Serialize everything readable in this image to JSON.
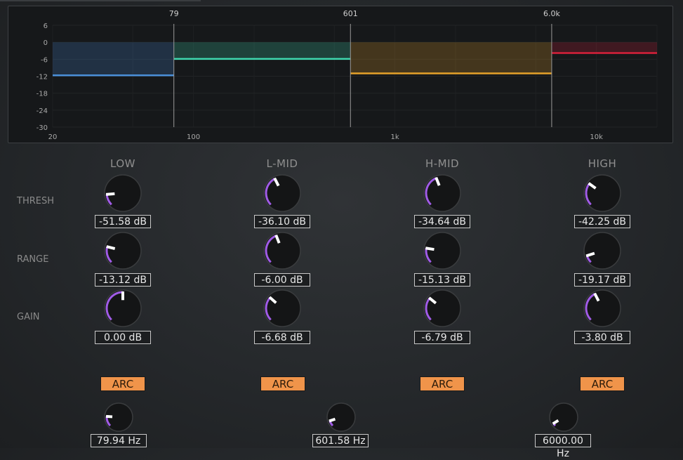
{
  "graph": {
    "y_ticks": [
      "6",
      "0",
      "-6",
      "-12",
      "-18",
      "-24",
      "-30"
    ],
    "x_ticks": [
      "20",
      "100",
      "1k",
      "10k"
    ],
    "crossover_labels": [
      "79",
      "601",
      "6.0k"
    ],
    "band_colors": [
      "#4a8fd9",
      "#3fd9b0",
      "#e6a22a",
      "#d8203a"
    ],
    "band_levels_db": [
      -11.7,
      -5.9,
      -11.0,
      -3.8
    ]
  },
  "bands": [
    {
      "title": "LOW",
      "thresh": "-51.58 dB",
      "range": "-13.12 dB",
      "gain": "0.00 dB",
      "arc": "ARC",
      "thresh_frac": 0.15,
      "range_frac": 0.22,
      "gain_frac": 0.5
    },
    {
      "title": "L-MID",
      "thresh": "-36.10 dB",
      "range": "-6.00 dB",
      "gain": "-6.68 dB",
      "arc": "ARC",
      "thresh_frac": 0.4,
      "range_frac": 0.42,
      "gain_frac": 0.32
    },
    {
      "title": "H-MID",
      "thresh": "-34.64 dB",
      "range": "-15.13 dB",
      "gain": "-6.79 dB",
      "arc": "ARC",
      "thresh_frac": 0.42,
      "range_frac": 0.2,
      "gain_frac": 0.31
    },
    {
      "title": "HIGH",
      "thresh": "-42.25 dB",
      "range": "-19.17 dB",
      "gain": "-3.80 dB",
      "arc": "ARC",
      "thresh_frac": 0.3,
      "range_frac": 0.1,
      "gain_frac": 0.4
    }
  ],
  "row_labels": {
    "thresh": "THRESH",
    "range": "RANGE",
    "gain": "GAIN"
  },
  "crossovers": [
    {
      "value": "79.94 Hz",
      "frac": 0.18
    },
    {
      "value": "601.58 Hz",
      "frac": 0.1
    },
    {
      "value": "6000.00 Hz",
      "frac": 0.05
    }
  ],
  "colors": {
    "knob_arc": "#a05ce6",
    "knob_pointer": "#ffffff",
    "arc_button": "#f0944a"
  }
}
